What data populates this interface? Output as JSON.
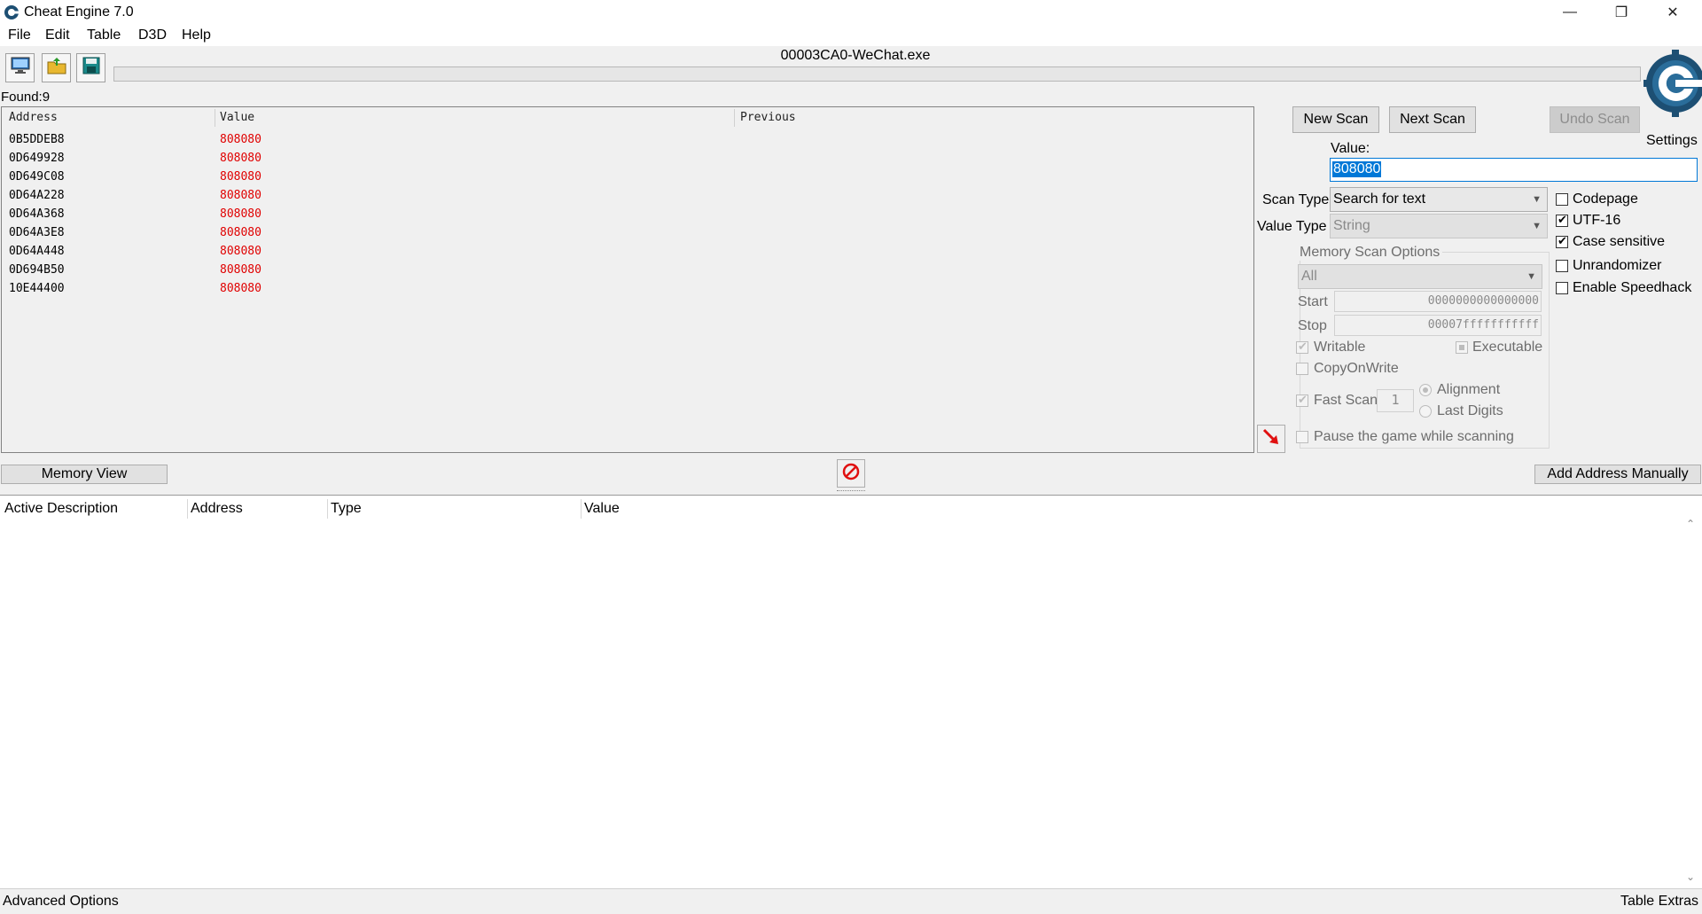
{
  "window": {
    "title": "Cheat Engine 7.0",
    "controls": {
      "minimize": "—",
      "maximize": "❐",
      "close": "✕"
    }
  },
  "menu": [
    "File",
    "Edit",
    "Table",
    "D3D",
    "Help"
  ],
  "toolbar": {
    "process_title": "00003CA0-WeChat.exe",
    "settings_label": "Settings"
  },
  "found": {
    "label": "Found:",
    "count": "9"
  },
  "results": {
    "columns": [
      "Address",
      "Value",
      "Previous"
    ],
    "rows": [
      {
        "address": "0B5DDEB8",
        "value": "808080"
      },
      {
        "address": "0D649928",
        "value": "808080"
      },
      {
        "address": "0D649C08",
        "value": "808080"
      },
      {
        "address": "0D64A228",
        "value": "808080"
      },
      {
        "address": "0D64A368",
        "value": "808080"
      },
      {
        "address": "0D64A3E8",
        "value": "808080"
      },
      {
        "address": "0D64A448",
        "value": "808080"
      },
      {
        "address": "0D694B50",
        "value": "808080"
      },
      {
        "address": "10E44400",
        "value": "808080"
      }
    ]
  },
  "scan": {
    "new_scan": "New Scan",
    "next_scan": "Next Scan",
    "undo_scan": "Undo Scan",
    "value_label": "Value:",
    "value": "808080",
    "scan_type_label": "Scan Type",
    "scan_type": "Search for text",
    "value_type_label": "Value Type",
    "value_type": "String",
    "memory_options_label": "Memory Scan Options",
    "region": "All",
    "start_label": "Start",
    "start_value": "0000000000000000",
    "stop_label": "Stop",
    "stop_value": "00007fffffffffff",
    "writable": "Writable",
    "executable": "Executable",
    "copy_on_write": "CopyOnWrite",
    "fast_scan": "Fast Scan",
    "fast_scan_value": "1",
    "alignment": "Alignment",
    "last_digits": "Last Digits",
    "pause_game": "Pause the game while scanning"
  },
  "options": {
    "codepage": "Codepage",
    "utf16": "UTF-16",
    "case_sensitive": "Case sensitive",
    "unrandomizer": "Unrandomizer",
    "speedhack": "Enable Speedhack"
  },
  "actions": {
    "memory_view": "Memory View",
    "add_address": "Add Address Manually"
  },
  "address_table": {
    "columns": [
      "Active Description",
      "Address",
      "Type",
      "Value"
    ]
  },
  "status": {
    "advanced_options": "Advanced Options",
    "table_extras": "Table Extras"
  },
  "colors": {
    "accent_selection": "#0078d7",
    "found_value": "#e00000",
    "logo": "#1d4f73"
  }
}
